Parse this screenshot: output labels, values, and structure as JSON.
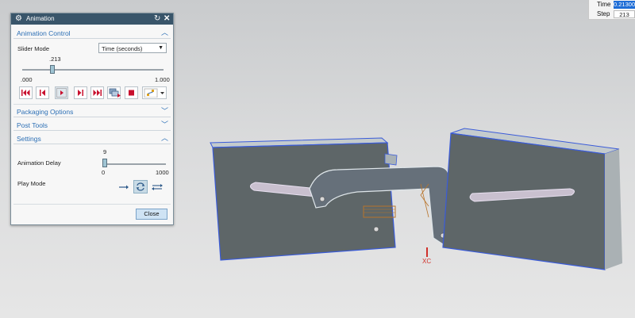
{
  "readout": {
    "time_label": "Time",
    "time_value": "0.213000",
    "step_label": "Step",
    "step_value": "213"
  },
  "dialog": {
    "title": "Animation",
    "animation_control": {
      "header": "Animation Control",
      "slider_mode_label": "Slider Mode",
      "slider_mode_value": "Time (seconds)",
      "slider_value_label": ".213",
      "slider_value": 0.213,
      "min_label": ".000",
      "max_label": "1.000"
    },
    "packaging_options": {
      "header": "Packaging Options"
    },
    "post_tools": {
      "header": "Post Tools"
    },
    "settings": {
      "header": "Settings",
      "delay_label": "Animation Delay",
      "delay_value_label": "9",
      "delay_value": 9,
      "delay_min": "0",
      "delay_max": "1000",
      "play_mode_label": "Play Mode",
      "play_mode_selected": "loop"
    },
    "close_label": "Close"
  },
  "viewport": {
    "axis_label": "XC",
    "colors": {
      "plate_face": "#5e6668",
      "plate_top": "#c4cbcd",
      "edge_highlight": "#3a5bd9",
      "axis_red": "#d0302a",
      "part_orange": "#b8742a"
    }
  }
}
